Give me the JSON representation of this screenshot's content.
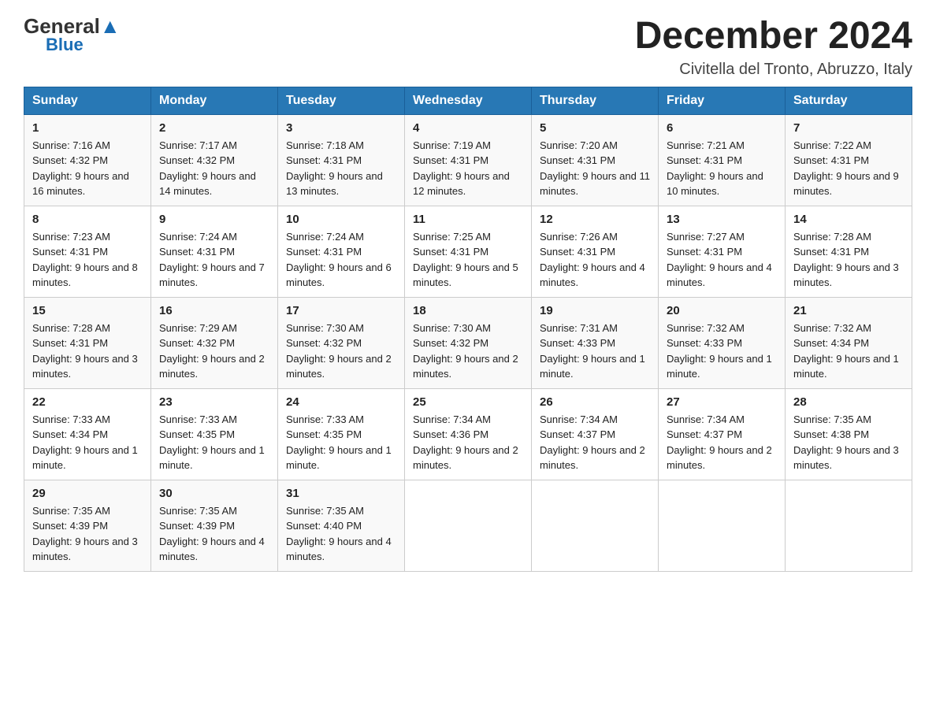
{
  "header": {
    "logo_general": "General",
    "logo_blue": "Blue",
    "month_year": "December 2024",
    "location": "Civitella del Tronto, Abruzzo, Italy"
  },
  "days_of_week": [
    "Sunday",
    "Monday",
    "Tuesday",
    "Wednesday",
    "Thursday",
    "Friday",
    "Saturday"
  ],
  "weeks": [
    [
      {
        "day": "1",
        "sunrise": "Sunrise: 7:16 AM",
        "sunset": "Sunset: 4:32 PM",
        "daylight": "Daylight: 9 hours and 16 minutes."
      },
      {
        "day": "2",
        "sunrise": "Sunrise: 7:17 AM",
        "sunset": "Sunset: 4:32 PM",
        "daylight": "Daylight: 9 hours and 14 minutes."
      },
      {
        "day": "3",
        "sunrise": "Sunrise: 7:18 AM",
        "sunset": "Sunset: 4:31 PM",
        "daylight": "Daylight: 9 hours and 13 minutes."
      },
      {
        "day": "4",
        "sunrise": "Sunrise: 7:19 AM",
        "sunset": "Sunset: 4:31 PM",
        "daylight": "Daylight: 9 hours and 12 minutes."
      },
      {
        "day": "5",
        "sunrise": "Sunrise: 7:20 AM",
        "sunset": "Sunset: 4:31 PM",
        "daylight": "Daylight: 9 hours and 11 minutes."
      },
      {
        "day": "6",
        "sunrise": "Sunrise: 7:21 AM",
        "sunset": "Sunset: 4:31 PM",
        "daylight": "Daylight: 9 hours and 10 minutes."
      },
      {
        "day": "7",
        "sunrise": "Sunrise: 7:22 AM",
        "sunset": "Sunset: 4:31 PM",
        "daylight": "Daylight: 9 hours and 9 minutes."
      }
    ],
    [
      {
        "day": "8",
        "sunrise": "Sunrise: 7:23 AM",
        "sunset": "Sunset: 4:31 PM",
        "daylight": "Daylight: 9 hours and 8 minutes."
      },
      {
        "day": "9",
        "sunrise": "Sunrise: 7:24 AM",
        "sunset": "Sunset: 4:31 PM",
        "daylight": "Daylight: 9 hours and 7 minutes."
      },
      {
        "day": "10",
        "sunrise": "Sunrise: 7:24 AM",
        "sunset": "Sunset: 4:31 PM",
        "daylight": "Daylight: 9 hours and 6 minutes."
      },
      {
        "day": "11",
        "sunrise": "Sunrise: 7:25 AM",
        "sunset": "Sunset: 4:31 PM",
        "daylight": "Daylight: 9 hours and 5 minutes."
      },
      {
        "day": "12",
        "sunrise": "Sunrise: 7:26 AM",
        "sunset": "Sunset: 4:31 PM",
        "daylight": "Daylight: 9 hours and 4 minutes."
      },
      {
        "day": "13",
        "sunrise": "Sunrise: 7:27 AM",
        "sunset": "Sunset: 4:31 PM",
        "daylight": "Daylight: 9 hours and 4 minutes."
      },
      {
        "day": "14",
        "sunrise": "Sunrise: 7:28 AM",
        "sunset": "Sunset: 4:31 PM",
        "daylight": "Daylight: 9 hours and 3 minutes."
      }
    ],
    [
      {
        "day": "15",
        "sunrise": "Sunrise: 7:28 AM",
        "sunset": "Sunset: 4:31 PM",
        "daylight": "Daylight: 9 hours and 3 minutes."
      },
      {
        "day": "16",
        "sunrise": "Sunrise: 7:29 AM",
        "sunset": "Sunset: 4:32 PM",
        "daylight": "Daylight: 9 hours and 2 minutes."
      },
      {
        "day": "17",
        "sunrise": "Sunrise: 7:30 AM",
        "sunset": "Sunset: 4:32 PM",
        "daylight": "Daylight: 9 hours and 2 minutes."
      },
      {
        "day": "18",
        "sunrise": "Sunrise: 7:30 AM",
        "sunset": "Sunset: 4:32 PM",
        "daylight": "Daylight: 9 hours and 2 minutes."
      },
      {
        "day": "19",
        "sunrise": "Sunrise: 7:31 AM",
        "sunset": "Sunset: 4:33 PM",
        "daylight": "Daylight: 9 hours and 1 minute."
      },
      {
        "day": "20",
        "sunrise": "Sunrise: 7:32 AM",
        "sunset": "Sunset: 4:33 PM",
        "daylight": "Daylight: 9 hours and 1 minute."
      },
      {
        "day": "21",
        "sunrise": "Sunrise: 7:32 AM",
        "sunset": "Sunset: 4:34 PM",
        "daylight": "Daylight: 9 hours and 1 minute."
      }
    ],
    [
      {
        "day": "22",
        "sunrise": "Sunrise: 7:33 AM",
        "sunset": "Sunset: 4:34 PM",
        "daylight": "Daylight: 9 hours and 1 minute."
      },
      {
        "day": "23",
        "sunrise": "Sunrise: 7:33 AM",
        "sunset": "Sunset: 4:35 PM",
        "daylight": "Daylight: 9 hours and 1 minute."
      },
      {
        "day": "24",
        "sunrise": "Sunrise: 7:33 AM",
        "sunset": "Sunset: 4:35 PM",
        "daylight": "Daylight: 9 hours and 1 minute."
      },
      {
        "day": "25",
        "sunrise": "Sunrise: 7:34 AM",
        "sunset": "Sunset: 4:36 PM",
        "daylight": "Daylight: 9 hours and 2 minutes."
      },
      {
        "day": "26",
        "sunrise": "Sunrise: 7:34 AM",
        "sunset": "Sunset: 4:37 PM",
        "daylight": "Daylight: 9 hours and 2 minutes."
      },
      {
        "day": "27",
        "sunrise": "Sunrise: 7:34 AM",
        "sunset": "Sunset: 4:37 PM",
        "daylight": "Daylight: 9 hours and 2 minutes."
      },
      {
        "day": "28",
        "sunrise": "Sunrise: 7:35 AM",
        "sunset": "Sunset: 4:38 PM",
        "daylight": "Daylight: 9 hours and 3 minutes."
      }
    ],
    [
      {
        "day": "29",
        "sunrise": "Sunrise: 7:35 AM",
        "sunset": "Sunset: 4:39 PM",
        "daylight": "Daylight: 9 hours and 3 minutes."
      },
      {
        "day": "30",
        "sunrise": "Sunrise: 7:35 AM",
        "sunset": "Sunset: 4:39 PM",
        "daylight": "Daylight: 9 hours and 4 minutes."
      },
      {
        "day": "31",
        "sunrise": "Sunrise: 7:35 AM",
        "sunset": "Sunset: 4:40 PM",
        "daylight": "Daylight: 9 hours and 4 minutes."
      },
      null,
      null,
      null,
      null
    ]
  ]
}
